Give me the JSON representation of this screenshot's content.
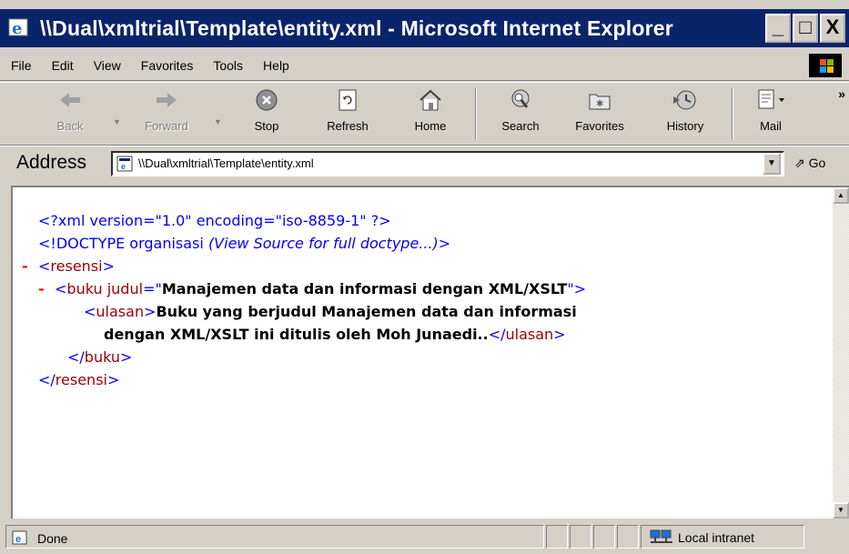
{
  "window": {
    "title": "\\\\Dual\\xmltrial\\Template\\entity.xml - Microsoft Internet Explorer",
    "min_label": "_",
    "max_label": "□",
    "close_label": "X"
  },
  "menu": [
    "File",
    "Edit",
    "View",
    "Favorites",
    "Tools",
    "Help"
  ],
  "toolbar": {
    "back": "Back",
    "forward": "Forward",
    "stop": "Stop",
    "refresh": "Refresh",
    "home": "Home",
    "search": "Search",
    "favorites": "Favorites",
    "history": "History",
    "mail": "Mail",
    "more": "»"
  },
  "address": {
    "label": "Address",
    "value": "\\\\Dual\\xmltrial\\Template\\entity.xml",
    "go": "Go"
  },
  "xml": {
    "decl": "<?xml version=\"1.0\" encoding=\"iso-8859-1\" ?>",
    "doctype_start": "<!DOCTYPE organisasi ",
    "doctype_note": "(View Source for full doctype...)",
    "doctype_end": ">",
    "minus": "-",
    "lt": "<",
    "gt": ">",
    "lt_close": "</",
    "resensi": "resensi",
    "buku": "buku",
    "attr_name": " judul",
    "eq": "=\"",
    "attr_value": "Manajemen data dan informasi dengan XML/XSLT",
    "quote_close": "\">",
    "ulasan": "ulasan",
    "text_line1": "Buku yang berjudul Manajemen data dan informasi",
    "text_line2": "dengan XML/XSLT ini ditulis oleh Moh Junaedi.."
  },
  "status": {
    "text": "Done",
    "zone": "Local intranet"
  }
}
